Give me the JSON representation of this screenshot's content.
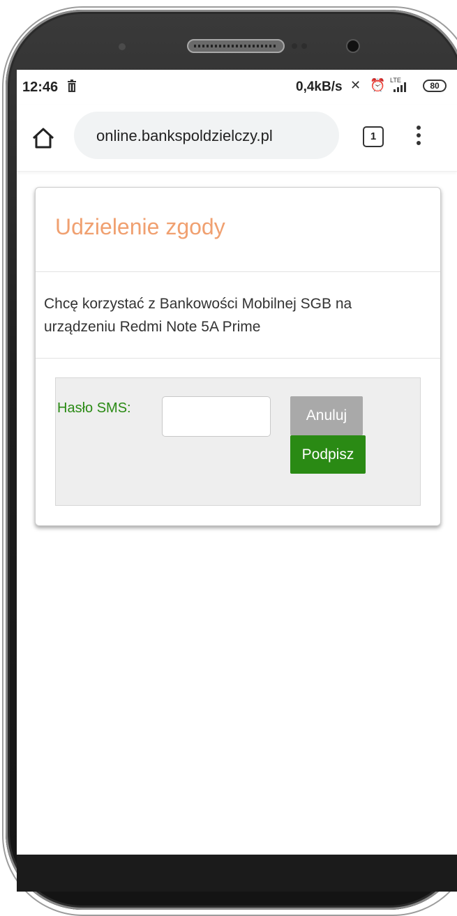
{
  "status_bar": {
    "time": "12:46",
    "speed": "0,4kB/s",
    "network": "LTE",
    "battery": "80"
  },
  "browser": {
    "url": "online.bankspoldzielczy.pl",
    "tab_count": "1"
  },
  "consent_card": {
    "title": "Udzielenie zgody",
    "message": "Chcę korzystać z Bankowości Mobilnej SGB na urządzeniu Redmi Note 5A Prime",
    "sms_label": "Hasło SMS:",
    "sms_value": "",
    "cancel_label": "Anuluj",
    "sign_label": "Podpisz"
  },
  "colors": {
    "title_orange": "#f0a070",
    "accent_green": "#2a8a14",
    "cancel_gray": "#a9a9a9"
  }
}
